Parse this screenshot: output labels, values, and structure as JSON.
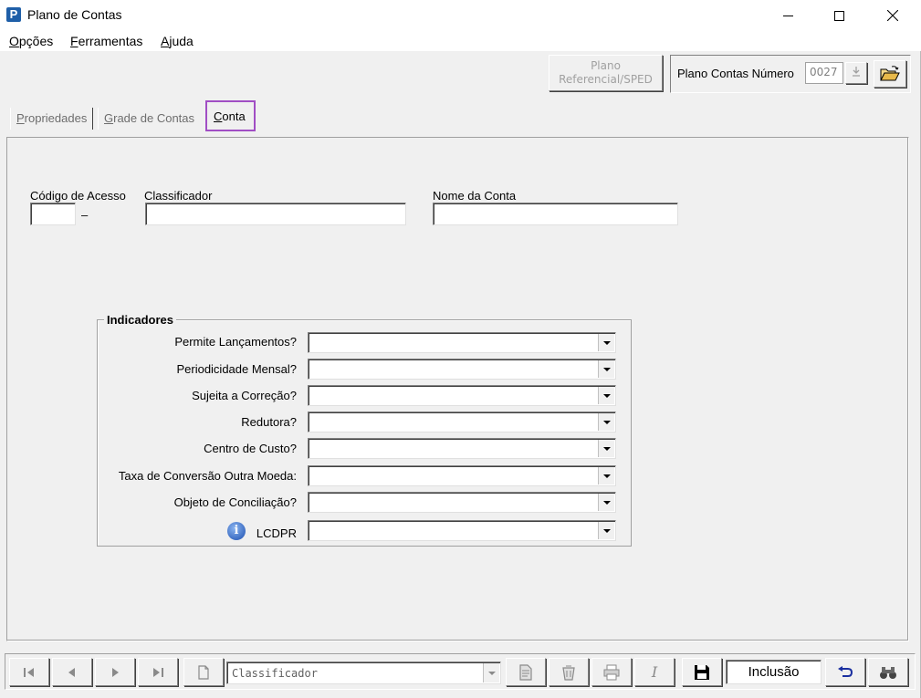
{
  "window": {
    "title": "Plano de Contas",
    "icon_letter": "P"
  },
  "menu": {
    "items": [
      {
        "mnemonic": "O",
        "rest": "pções"
      },
      {
        "mnemonic": "F",
        "rest": "erramentas"
      },
      {
        "mnemonic": "A",
        "rest": "juda"
      }
    ]
  },
  "header": {
    "sped_button_line1": "Plano",
    "sped_button_line2": "Referencial/SPED",
    "plano_label": "Plano Contas Número",
    "plano_number": "0027"
  },
  "tabs": [
    {
      "mnemonic": "P",
      "rest": "ropriedades"
    },
    {
      "mnemonic": "G",
      "rest": "rade de Contas"
    },
    {
      "mnemonic": "C",
      "rest": "onta"
    }
  ],
  "form": {
    "codigo_label": "Código de Acesso",
    "codigo_value": "",
    "separator": "–",
    "classificador_label": "Classificador",
    "classificador_value": "",
    "nome_label": "Nome da Conta",
    "nome_value": ""
  },
  "indicators": {
    "title": "Indicadores",
    "rows": [
      {
        "label": "Permite Lançamentos?",
        "value": ""
      },
      {
        "label": "Periodicidade Mensal?",
        "value": ""
      },
      {
        "label": "Sujeita a Correção?",
        "value": ""
      },
      {
        "label": "Redutora?",
        "value": ""
      },
      {
        "label": "Centro de Custo?",
        "value": ""
      },
      {
        "label": "Taxa de Conversão Outra Moeda:",
        "value": ""
      },
      {
        "label": "Objeto de Conciliação?",
        "value": ""
      },
      {
        "label": "LCDPR",
        "value": ""
      }
    ]
  },
  "toolbar": {
    "search_field": "Classificador",
    "status": "Inclusão",
    "edit_italic": "I"
  },
  "colors": {
    "active_tab_highlight": "#a14ec4",
    "background": "#f0f0f0"
  }
}
